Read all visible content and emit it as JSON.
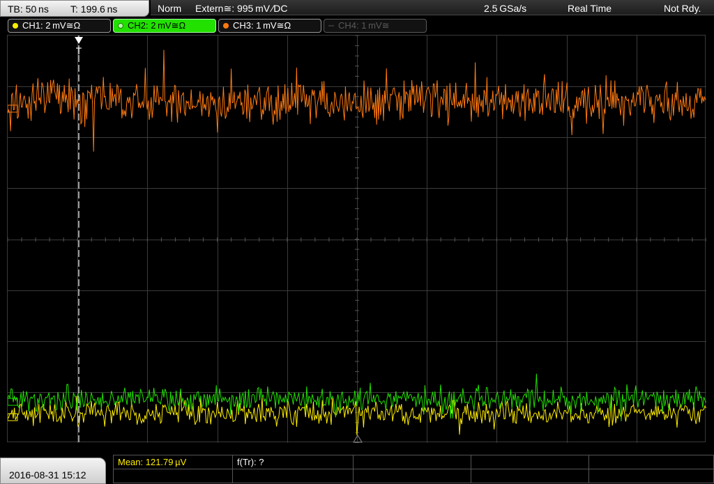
{
  "status_bar": {
    "timebase": "TB: 50 ns",
    "trigger_time": "T: 199.6 ns",
    "trigger_mode": "Norm",
    "trigger_source": "Extern≅: 995 mV ∕DC",
    "sample_rate": "2.5 GSa/s",
    "acq_mode": "Real Time",
    "state": "Not Rdy."
  },
  "channels": [
    {
      "label": "CH1: 2 mV≅Ω",
      "color": "#ffee00",
      "active": false,
      "enabled": true
    },
    {
      "label": "CH2: 2 mV≅Ω",
      "color": "#22e000",
      "active": true,
      "enabled": true
    },
    {
      "label": "CH3: 1 mV≅Ω",
      "color": "#ff7a10",
      "active": false,
      "enabled": true
    },
    {
      "label": "CH4: 1 mV≅",
      "color": "#444444",
      "active": false,
      "enabled": false
    }
  ],
  "trace_colors": {
    "ch1": "#ffee00",
    "ch2": "#22e000",
    "ch3": "#ff7a10",
    "grid": "#3c3c3c"
  },
  "trigger_marker": {
    "label": "T"
  },
  "bottom": {
    "datetime": "2016-08-31 15:12",
    "measurements": [
      {
        "label": "Mean: 121.79 µV",
        "color": "#ffee00"
      },
      {
        "label": "f(Tr): ?",
        "color": "#ffffff"
      }
    ]
  }
}
